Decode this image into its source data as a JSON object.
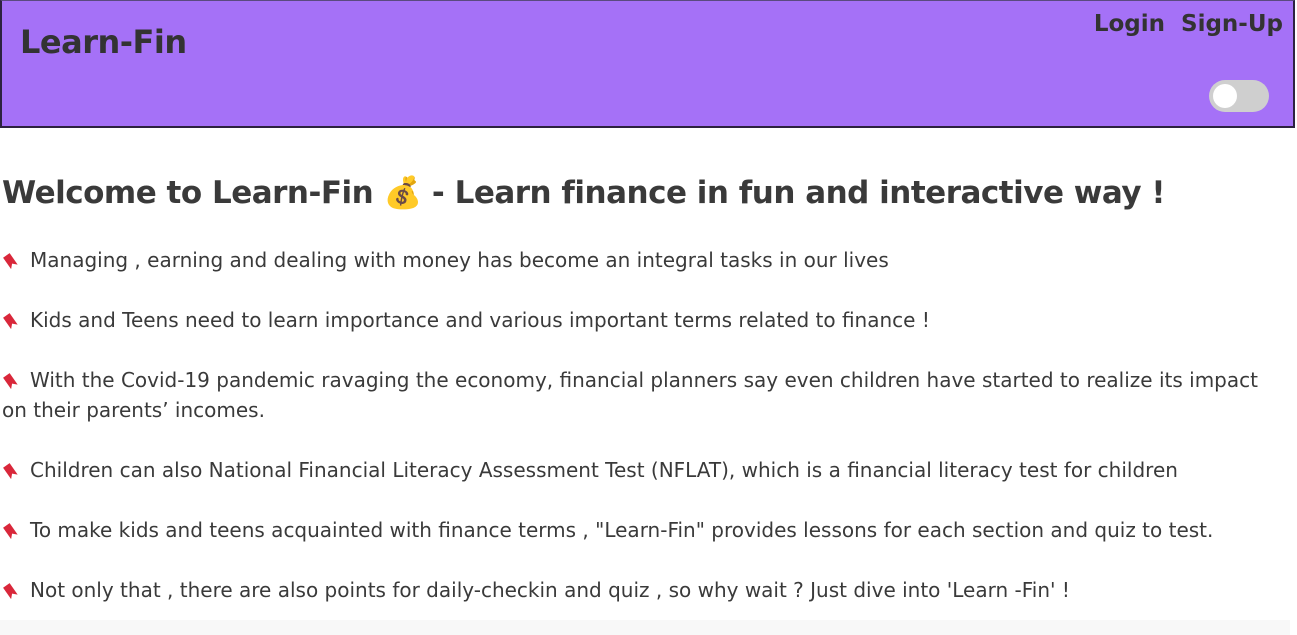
{
  "header": {
    "brand": "Learn-Fin",
    "login": "Login",
    "signup": "Sign-Up",
    "theme_toggle_state": "off"
  },
  "main": {
    "title": "Welcome to Learn-Fin 💰 - Learn finance in fun and interactive way !",
    "bullet_icon": "bookmark-icon",
    "paragraphs": [
      "Managing , earning and dealing with money has become an integral tasks in our lives",
      "Kids and Teens need to learn importance and various important terms related to finance !",
      "With the Covid-19 pandemic ravaging the economy, financial planners say even children have started to realize its impact on their parents’ incomes.",
      "Children can also National Financial Literacy Assessment Test (NFLAT), which is a financial literacy test for children",
      "To make kids and teens acquainted with finance terms , \"Learn-Fin\" provides lessons for each section and quiz to test.",
      "Not only that , there are also points for daily-checkin and quiz , so why wait ? Just dive into 'Learn -Fin' !"
    ]
  },
  "colors": {
    "navbar": "#a571f7",
    "text": "#3a3a3a",
    "bullet": "#d9273a",
    "toggle": "#cfcfcf"
  }
}
